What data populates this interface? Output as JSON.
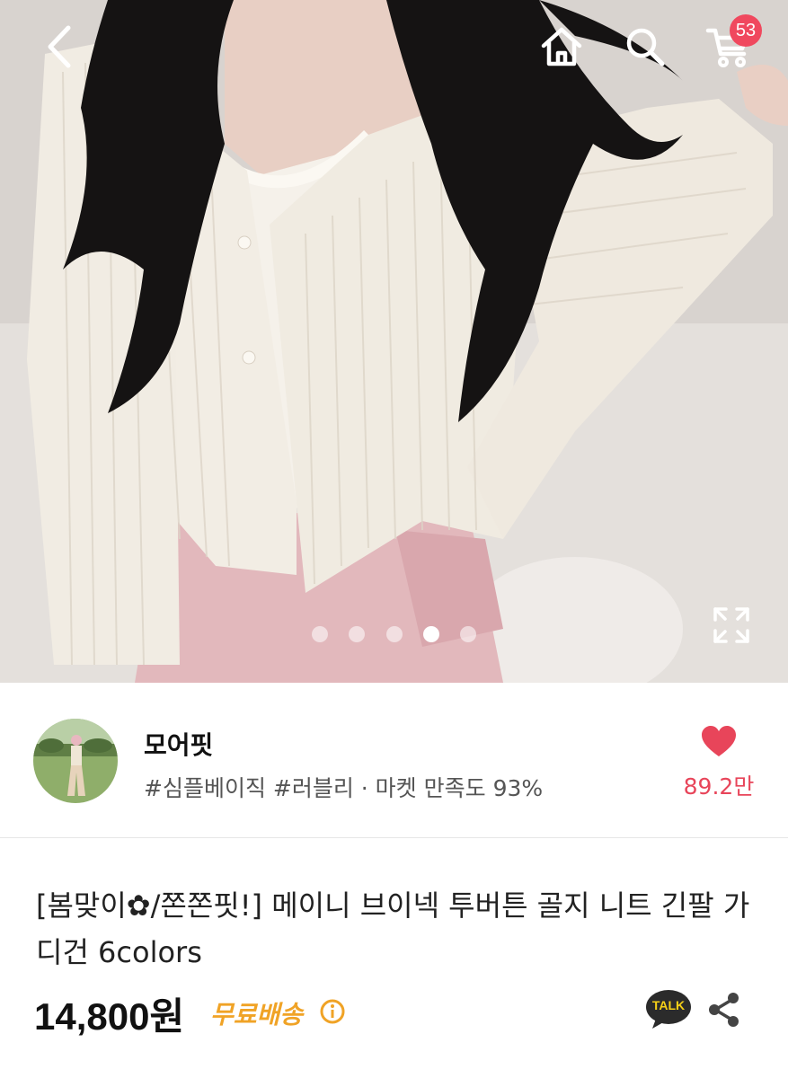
{
  "header": {
    "back_icon": "chevron-left-icon",
    "home_icon": "home-icon",
    "search_icon": "search-icon",
    "cart_icon": "cart-icon",
    "cart_count": "53"
  },
  "gallery": {
    "total_images": 5,
    "current_index": 4,
    "expand_icon": "expand-icon"
  },
  "seller": {
    "name": "모어핏",
    "tags": "#심플베이직 #러블리 · 마켓 만족도 93%",
    "like_count": "89.2만"
  },
  "product": {
    "title": "[봄맞이✿/쫀쫀핏!] 메이니 브이넥 투버튼 골지 니트 긴팔 가디건 6colors",
    "price": "14,800원",
    "shipping": "무료배송"
  },
  "actions": {
    "talk_label": "TALK",
    "share_icon": "share-icon"
  },
  "colors": {
    "accent_pink": "#f0485e",
    "heart_red": "#e8455a",
    "shipping_orange": "#f0a326",
    "talk_bg": "#2b2b2b",
    "talk_text": "#f7d117"
  }
}
